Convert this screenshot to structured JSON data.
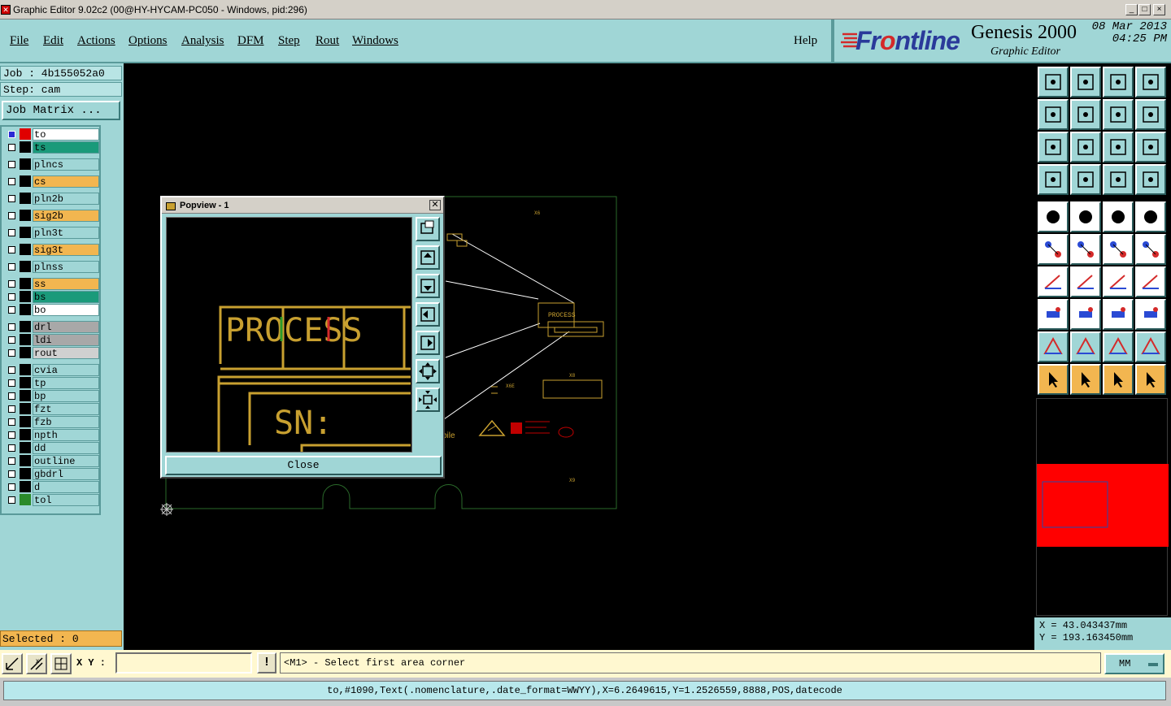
{
  "window": {
    "title": "Graphic Editor 9.02c2 (00@HY-HYCAM-PC050 - Windows, pid:296)",
    "min": "_",
    "max": "□",
    "close": "×"
  },
  "menu": {
    "items": [
      "File",
      "Edit",
      "Actions",
      "Options",
      "Analysis",
      "DFM",
      "Step",
      "Rout",
      "Windows"
    ],
    "help": "Help"
  },
  "brand": {
    "logo_pre": "Fr",
    "logo_o": "o",
    "logo_post": "ntline",
    "product": "Genesis 2000",
    "subtitle": "Graphic Editor",
    "date": "08 Mar 2013",
    "time": "04:25 PM"
  },
  "job": {
    "job_line": "Job : 4b155052a0",
    "step_line": "Step: cam",
    "matrix_button": "Job Matrix ..."
  },
  "layers": [
    {
      "name": "to",
      "color": "#ffffff",
      "swatch": "#e00000",
      "active": true
    },
    {
      "name": "ts",
      "color": "#1a9a7a",
      "swatch": "#000000"
    },
    {
      "name": "plncs",
      "color": "#a0d6d6",
      "swatch": "#000000"
    },
    {
      "name": "cs",
      "color": "#f2b650",
      "swatch": "#000000"
    },
    {
      "name": "pln2b",
      "color": "#a0d6d6",
      "swatch": "#000000"
    },
    {
      "name": "sig2b",
      "color": "#f2b650",
      "swatch": "#000000"
    },
    {
      "name": "pln3t",
      "color": "#a0d6d6",
      "swatch": "#000000"
    },
    {
      "name": "sig3t",
      "color": "#f2b650",
      "swatch": "#000000"
    },
    {
      "name": "plnss",
      "color": "#a0d6d6",
      "swatch": "#000000"
    },
    {
      "name": "ss",
      "color": "#f2b650",
      "swatch": "#000000"
    },
    {
      "name": "bs",
      "color": "#1a9a7a",
      "swatch": "#000000"
    },
    {
      "name": "bo",
      "color": "#ffffff",
      "swatch": "#000000"
    },
    {
      "name": "drl",
      "color": "#a8a8a8",
      "swatch": "#000000"
    },
    {
      "name": "ldi",
      "color": "#a8a8a8",
      "swatch": "#000000"
    },
    {
      "name": "rout",
      "color": "#d0d0d0",
      "swatch": "#000000"
    },
    {
      "name": "cvia",
      "color": "#a0d6d6",
      "swatch": "#000000"
    },
    {
      "name": "tp",
      "color": "#a0d6d6",
      "swatch": "#000000"
    },
    {
      "name": "bp",
      "color": "#a0d6d6",
      "swatch": "#000000"
    },
    {
      "name": "fzt",
      "color": "#a0d6d6",
      "swatch": "#000000"
    },
    {
      "name": "fzb",
      "color": "#a0d6d6",
      "swatch": "#000000"
    },
    {
      "name": "npth",
      "color": "#a0d6d6",
      "swatch": "#000000"
    },
    {
      "name": "dd",
      "color": "#a0d6d6",
      "swatch": "#000000"
    },
    {
      "name": "outline",
      "color": "#a0d6d6",
      "swatch": "#000000"
    },
    {
      "name": "gbdrl",
      "color": "#a0d6d6",
      "swatch": "#000000"
    },
    {
      "name": "d",
      "color": "#a0d6d6",
      "swatch": "#000000"
    },
    {
      "name": "tol",
      "color": "#a0d6d6",
      "swatch": "#2a8a2a"
    }
  ],
  "selected": "Selected : 0",
  "xy_label": "X Y :",
  "xy_value": "",
  "message": "<M1> - Select first area corner",
  "units": "MM",
  "status": "to,#1090,Text(.nomenclature,.date_format=WWYY),X=6.2649615,Y=1.2526559,8888,POS,datecode",
  "coords": {
    "x": "X  =  43.043437mm",
    "y": "Y  =  193.163450mm"
  },
  "popview": {
    "title": "Popview - 1",
    "close": "Close",
    "text_process": "PROCESS",
    "text_sn": "SN:"
  },
  "canvas": {
    "labels": [
      "PROCESS",
      "X6",
      "X8",
      "X6E",
      "X9",
      "bile"
    ]
  }
}
